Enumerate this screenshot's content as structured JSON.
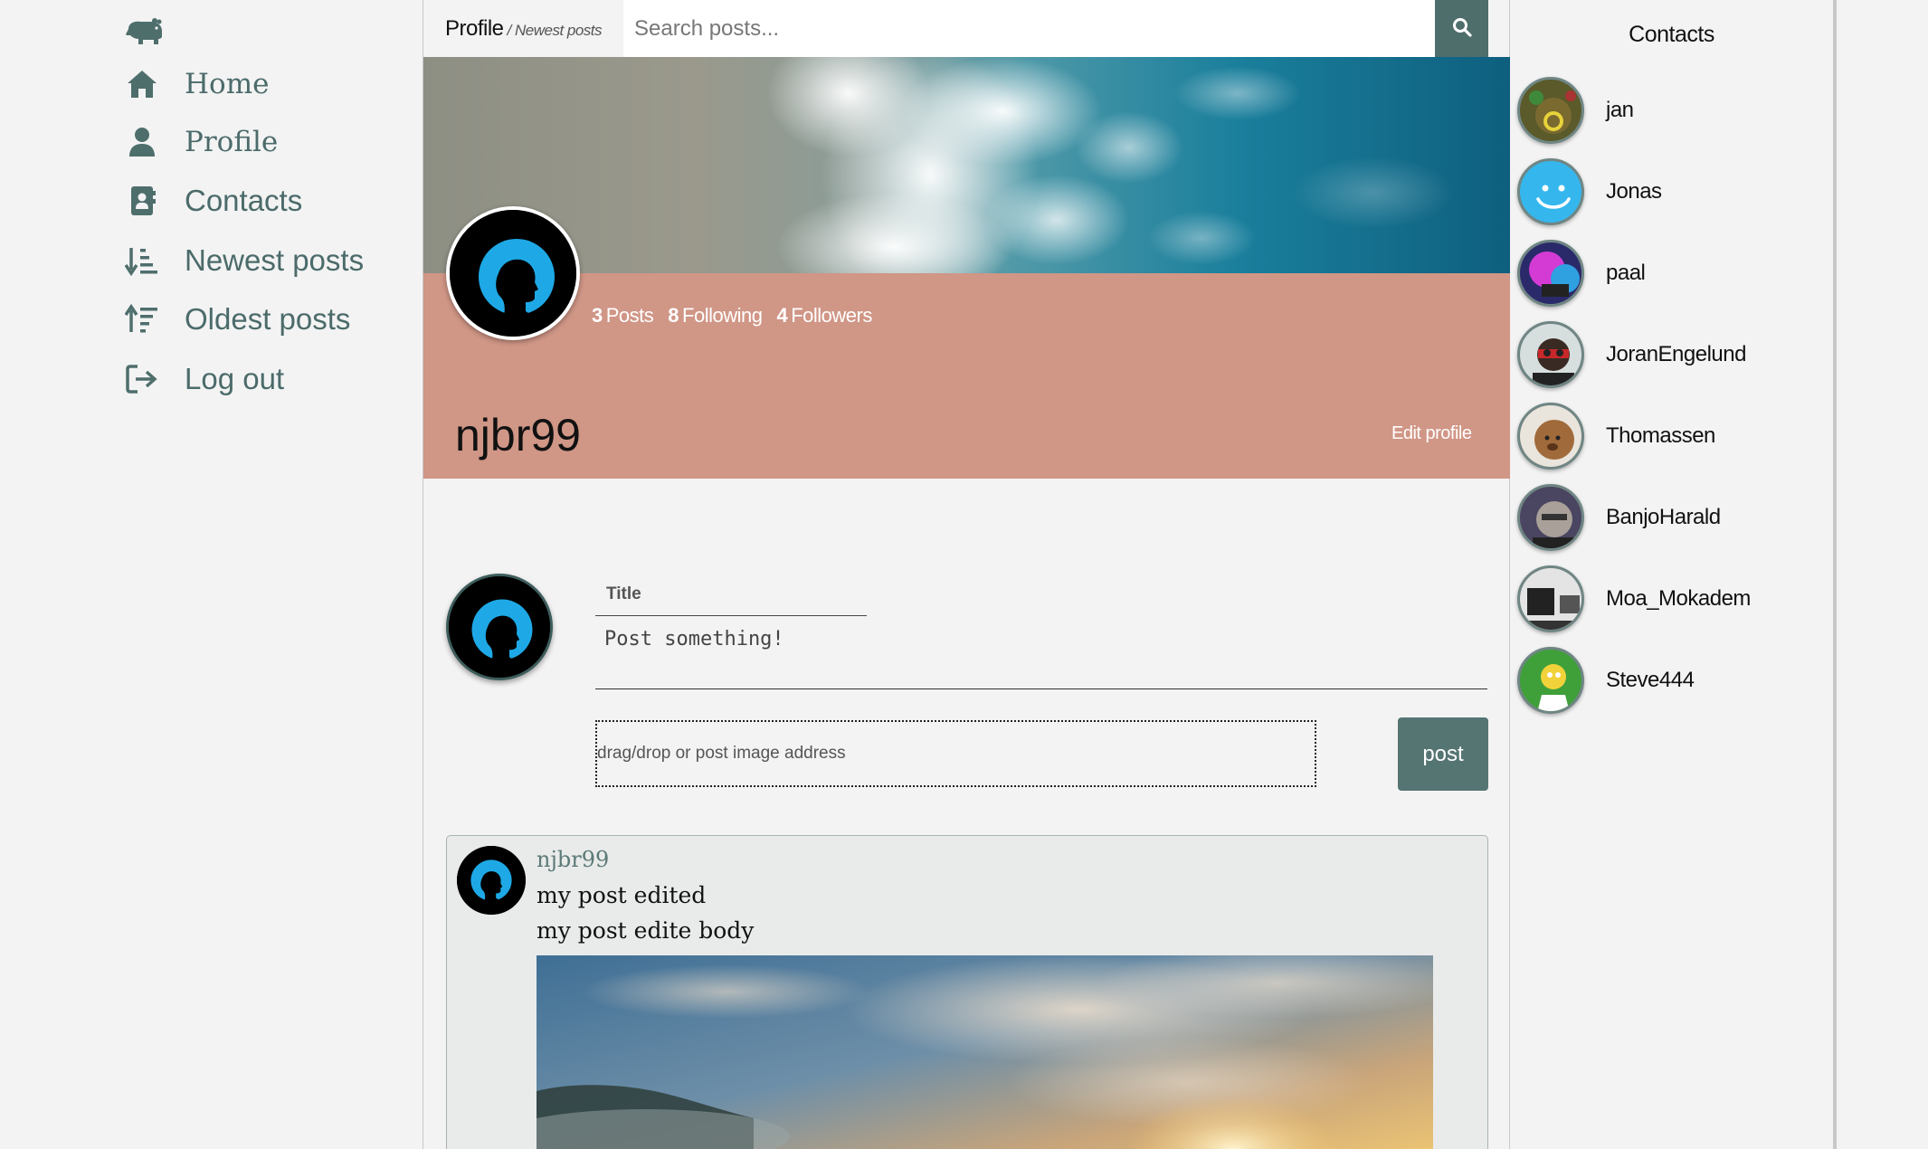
{
  "sidebar": {
    "logo": "hippo-logo-icon",
    "items": [
      {
        "label": "Home",
        "icon": "home-icon"
      },
      {
        "label": "Profile",
        "icon": "user-icon"
      },
      {
        "label": "Contacts",
        "icon": "address-book-icon"
      },
      {
        "label": "Newest posts",
        "icon": "sort-down-icon"
      },
      {
        "label": "Oldest posts",
        "icon": "sort-up-icon"
      },
      {
        "label": "Log out",
        "icon": "logout-icon"
      }
    ]
  },
  "header": {
    "breadcrumb_main": "Profile",
    "breadcrumb_sub": "/ Newest posts",
    "search_placeholder": "Search posts..."
  },
  "profile": {
    "username": "njbr99",
    "posts_count": "3",
    "posts_label": "Posts",
    "following_count": "8",
    "following_label": "Following",
    "followers_count": "4",
    "followers_label": "Followers",
    "edit_label": "Edit profile",
    "band_color": "#d09686"
  },
  "composer": {
    "title_label": "Title",
    "body_placeholder": "Post something!",
    "image_placeholder": "drag/drop or post image address",
    "post_button": "post"
  },
  "posts": [
    {
      "user": "njbr99",
      "title": "my post edited",
      "body": "my post edite body"
    }
  ],
  "contacts": {
    "title": "Contacts",
    "items": [
      {
        "name": "jan"
      },
      {
        "name": "Jonas"
      },
      {
        "name": "paal"
      },
      {
        "name": "JoranEngelund"
      },
      {
        "name": "Thomassen"
      },
      {
        "name": "BanjoHarald"
      },
      {
        "name": "Moa_Mokadem"
      },
      {
        "name": "Steve444"
      }
    ]
  },
  "colors": {
    "accent": "#4e6e6c",
    "nav_text": "#4b6b6a",
    "profile_band": "#d09686"
  }
}
